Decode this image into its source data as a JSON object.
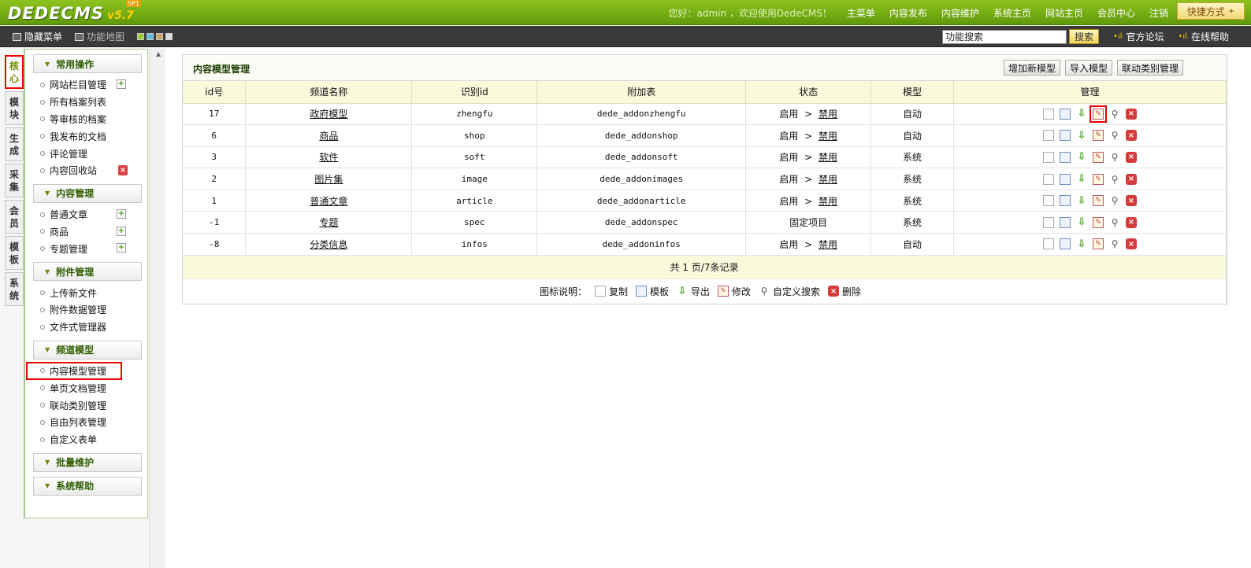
{
  "logo": {
    "text": "DEDECMS",
    "version": "v5.7",
    "tag": "SP1"
  },
  "topbar": {
    "welcome": "您好：admin ，欢迎使用DedeCMS！",
    "nav": [
      "主菜单",
      "内容发布",
      "内容维护",
      "系统主页",
      "网站主页",
      "会员中心",
      "注销"
    ],
    "quick": "快捷方式"
  },
  "toolbar": {
    "hide_menu": "隐藏菜单",
    "func_map": "功能地图",
    "search_value": "功能搜索",
    "search_btn": "搜索",
    "forum": "官方论坛",
    "help": "在线帮助"
  },
  "vtabs": [
    {
      "label": [
        "核",
        "心"
      ],
      "active": true
    },
    {
      "label": [
        "模",
        "块"
      ]
    },
    {
      "label": [
        "生",
        "成"
      ]
    },
    {
      "label": [
        "采",
        "集"
      ]
    },
    {
      "label": [
        "会",
        "员"
      ]
    },
    {
      "label": [
        "模",
        "板"
      ]
    },
    {
      "label": [
        "系",
        "统"
      ]
    }
  ],
  "menu": {
    "sec1": {
      "title": "常用操作",
      "items": [
        "网站栏目管理",
        "所有档案列表",
        "等审核的档案",
        "我发布的文档",
        "评论管理",
        "内容回收站"
      ]
    },
    "sec2": {
      "title": "内容管理",
      "items": [
        "普通文章",
        "商品",
        "专题管理"
      ]
    },
    "sec3": {
      "title": "附件管理",
      "items": [
        "上传新文件",
        "附件数据管理",
        "文件式管理器"
      ]
    },
    "sec4": {
      "title": "频道模型",
      "items": [
        "内容模型管理",
        "单页文档管理",
        "联动类别管理",
        "自由列表管理",
        "自定义表单"
      ]
    },
    "sec5": {
      "title": "批量维护"
    },
    "sec6": {
      "title": "系统帮助"
    }
  },
  "panel": {
    "title": "内容模型管理",
    "buttons": [
      "增加新模型",
      "导入模型",
      "联动类别管理"
    ],
    "headers": [
      "id号",
      "频道名称",
      "识别id",
      "附加表",
      "状态",
      "模型",
      "管理"
    ],
    "rows": [
      {
        "id": "17",
        "name": "政府模型",
        "nid": "zhengfu",
        "table": "dede_addonzhengfu",
        "status_on": "启用",
        "status_sep": ">",
        "status_off": "禁用",
        "model": "自动"
      },
      {
        "id": "6",
        "name": "商品",
        "nid": "shop",
        "table": "dede_addonshop",
        "status_on": "启用",
        "status_sep": ">",
        "status_off": "禁用",
        "model": "自动"
      },
      {
        "id": "3",
        "name": "软件",
        "nid": "soft",
        "table": "dede_addonsoft",
        "status_on": "启用",
        "status_sep": ">",
        "status_off": "禁用",
        "model": "系统"
      },
      {
        "id": "2",
        "name": "图片集",
        "nid": "image",
        "table": "dede_addonimages",
        "status_on": "启用",
        "status_sep": ">",
        "status_off": "禁用",
        "model": "系统"
      },
      {
        "id": "1",
        "name": "普通文章",
        "nid": "article",
        "table": "dede_addonarticle",
        "status_on": "启用",
        "status_sep": ">",
        "status_off": "禁用",
        "model": "系统"
      },
      {
        "id": "-1",
        "name": "专题",
        "nid": "spec",
        "table": "dede_addonspec",
        "status_fixed": "固定项目",
        "model": "系统"
      },
      {
        "id": "-8",
        "name": "分类信息",
        "nid": "infos",
        "table": "dede_addoninfos",
        "status_on": "启用",
        "status_sep": ">",
        "status_off": "禁用",
        "model": "自动"
      }
    ],
    "pager": "共 1 页/7条记录",
    "legend_title": "图标说明：",
    "legend": [
      "复制",
      "模板",
      "导出",
      "修改",
      "自定义搜索",
      "删除"
    ]
  }
}
